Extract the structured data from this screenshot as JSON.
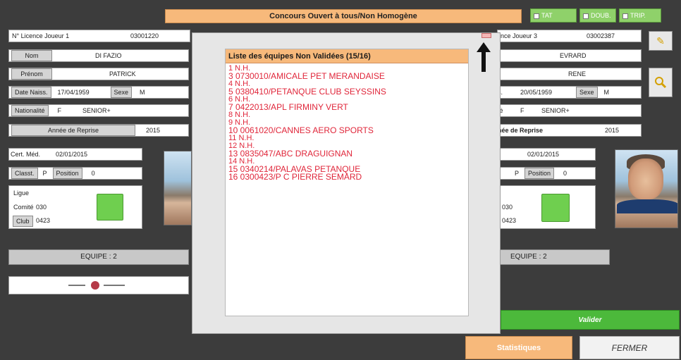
{
  "title": "Concours Ouvert à tous/Non Homogène",
  "modes": [
    "TAT",
    "DOUB.",
    "TRIP."
  ],
  "left_player": {
    "licence_label": "N° Licence Joueur 1",
    "licence_value": "03001220",
    "nom_label": "Nom",
    "nom_value": "DI FAZIO",
    "prenom_label": "Prénom",
    "prenom_value": "PATRICK",
    "date_label": "Date Naiss.",
    "date_value": "17/04/1959",
    "sexe_label": "Sexe",
    "sexe_value": "M",
    "nat_label": "Nationalité",
    "nat_value": "F",
    "cat_value": "SENIOR+",
    "reprise_label": "Année de Reprise",
    "reprise_value": "2015",
    "cert_label": "Cert. Méd.",
    "cert_value": "02/01/2015",
    "classt_label": "Classt.",
    "classt_value": "P",
    "position_label": "Position",
    "position_value": "0",
    "ligue_label": "Ligue",
    "comite_label": "Comité",
    "comite_value": "030",
    "club_label": "Club",
    "club_value": "0423",
    "equipe": "EQUIPE : 2"
  },
  "right_player": {
    "licence_label": "nce Joueur 3",
    "licence_value": "03002387",
    "nom_value": "EVRARD",
    "prenom_value": "RENE",
    "date_label": "s.",
    "date_value": "20/05/1959",
    "sexe_label": "Sexe",
    "sexe_value": "M",
    "nat_label": "té",
    "nat_value": "F",
    "cat_value": "SENIOR+",
    "reprise_label": "née de Reprise",
    "reprise_value": "2015",
    "cert_value": "02/01/2015",
    "classt_value": "P",
    "position_label": "Position",
    "position_value": "0",
    "comite_value": "030",
    "club_value": "0423",
    "equipe": "EQUIPE : 2"
  },
  "popup": {
    "header": "Liste des équipes Non Validées (15/16)",
    "items": [
      "1 N.H.",
      "3 0730010/AMICALE PET MERANDAISE",
      "4 N.H.",
      "5 0380410/PETANQUE CLUB SEYSSINS",
      "6 N.H.",
      "7 0422013/APL FIRMINY VERT",
      "8 N.H.",
      "9 N.H.",
      "10 0061020/CANNES AERO SPORTS",
      "11 N.H.",
      "12 N.H.",
      "13 0835047/ABC DRAGUIGNAN",
      "14 N.H.",
      "15 0340214/PALAVAS PETANQUE",
      "16 0300423/P C PIERRE SEMARD"
    ]
  },
  "actions": {
    "valider": "Valider",
    "statistiques": "Statistiques",
    "fermer": "FERMER"
  },
  "icons": {
    "search": "search-icon",
    "edit": "pencil-icon"
  }
}
